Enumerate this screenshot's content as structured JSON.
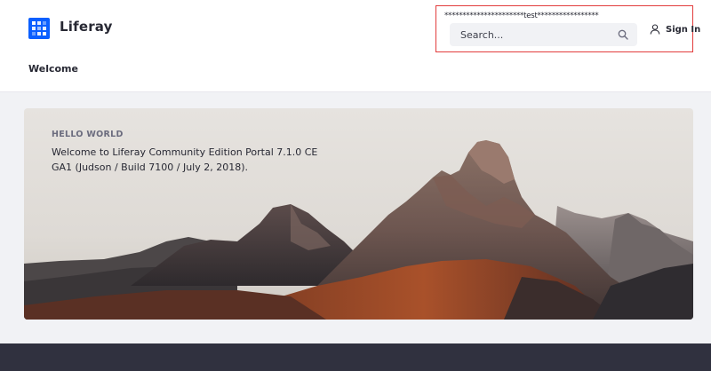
{
  "header": {
    "site_name": "Liferay",
    "nav": {
      "welcome_label": "Welcome"
    },
    "search": {
      "annotation": "**********************test*****************",
      "placeholder": "Search..."
    },
    "sign_in_label": "Sign In"
  },
  "hero": {
    "eyebrow": "HELLO WORLD",
    "text": "Welcome to Liferay Community Edition Portal 7.1.0 CE GA1 (Judson / Build 7100 / July 2, 2018)."
  },
  "colors": {
    "brand": "#0b5fff",
    "highlight": "#e23c3c",
    "footer": "#30313f"
  },
  "icons": [
    "liferay-logo-icon",
    "search-icon",
    "user-icon"
  ]
}
